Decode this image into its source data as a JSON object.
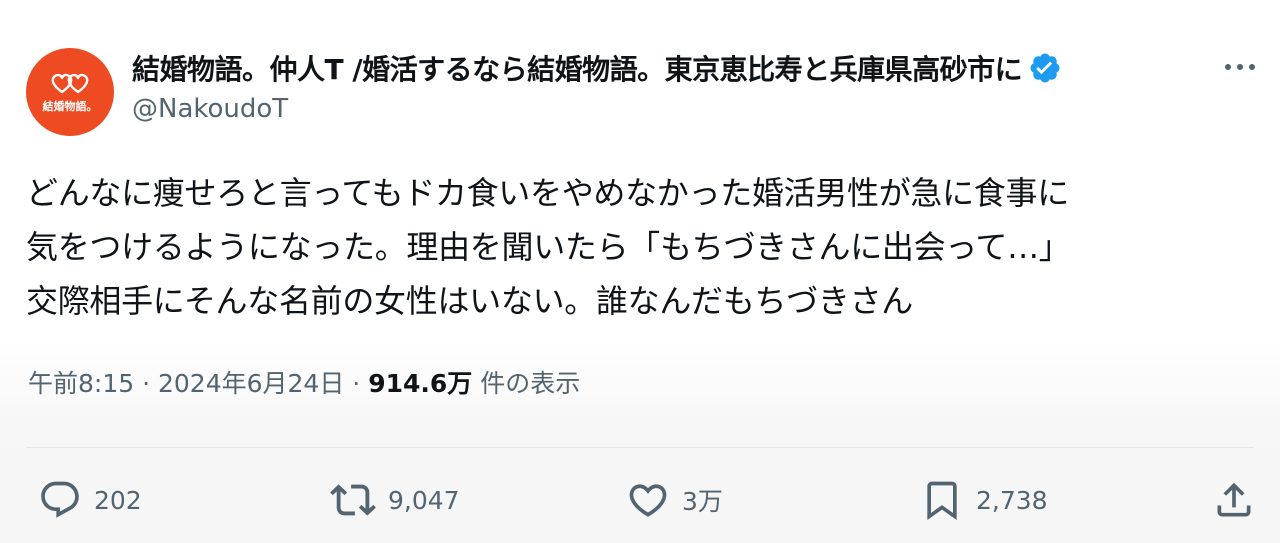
{
  "author": {
    "avatar_logo_text": "結婚物語。",
    "display_name": "結婚物語。仲人T /婚活するなら結婚物語。東京恵比寿と兵庫県高砂市に",
    "handle": "@NakoudoT",
    "verified": true,
    "avatar_color": "#ee4b22",
    "verified_color": "#1d9bf0"
  },
  "tweet": {
    "lines": [
      "どんなに痩せろと言ってもドカ食いをやめなかった婚活男性が急に食事に",
      "気をつけるようになった。理由を聞いたら「もちづきさんに出会って…」",
      "交際相手にそんな名前の女性はいない。誰なんだもちづきさん"
    ]
  },
  "meta": {
    "time": "午前8:15",
    "separator": "·",
    "date": "2024年6月24日",
    "views": "914.6万",
    "views_label": "件の表示"
  },
  "actions": {
    "replies": "202",
    "reposts": "9,047",
    "likes": "3万",
    "bookmarks": "2,738"
  },
  "icons": [
    "more-icon",
    "verified-badge-icon",
    "reply-icon",
    "repost-icon",
    "like-icon",
    "bookmark-icon",
    "share-icon"
  ]
}
